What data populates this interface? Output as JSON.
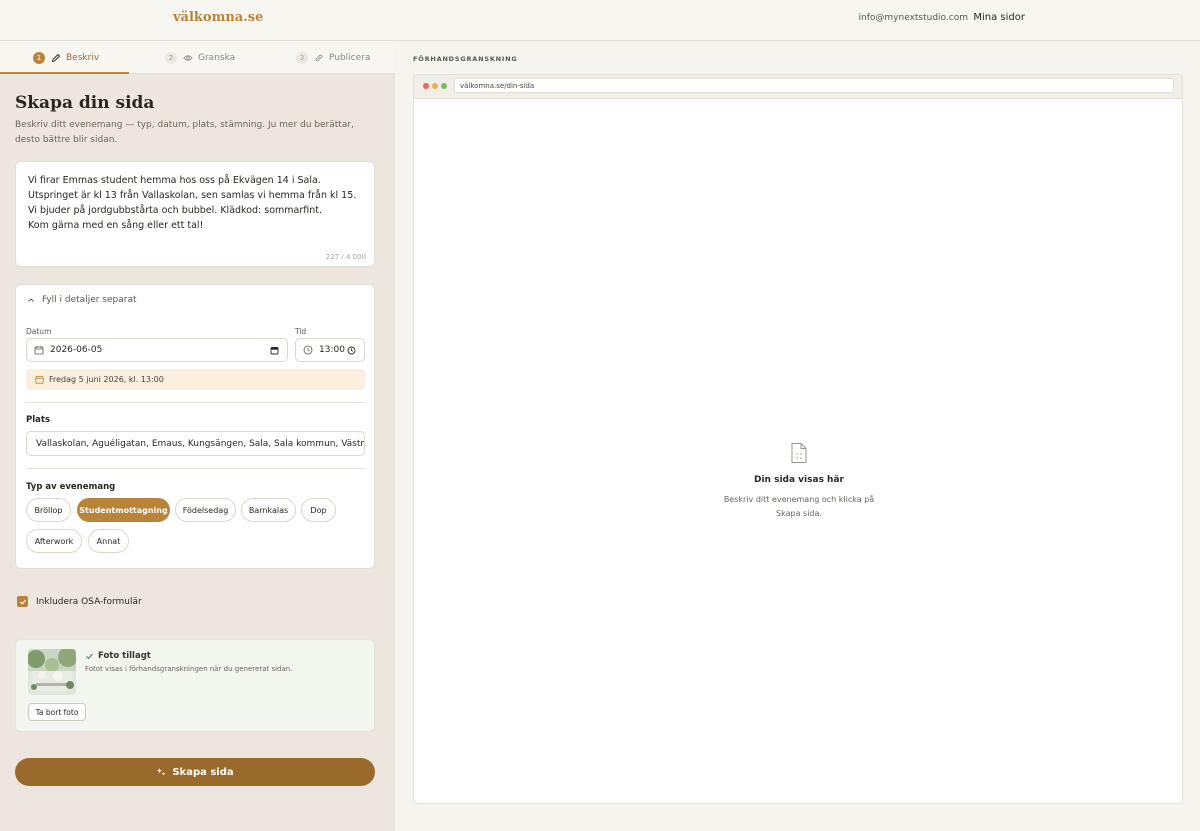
{
  "header": {
    "logo": "välkomna.se",
    "email": "info@mynextstudio.com",
    "my_pages": "Mina sidor"
  },
  "steps": [
    {
      "num": "1",
      "label": "Beskriv",
      "icon": "pencil-icon",
      "active": true
    },
    {
      "num": "2",
      "label": "Granska",
      "icon": "eye-icon",
      "active": false
    },
    {
      "num": "3",
      "label": "Publicera",
      "icon": "link-icon",
      "active": false
    }
  ],
  "form": {
    "title": "Skapa din sida",
    "subtitle": "Beskriv ditt evenemang — typ, datum, plats, stämning. Ju mer du berättar, desto bättre blir sidan.",
    "description": "Vi firar Emmas student hemma hos oss på Ekvägen 14 i Sala. Utspringet är kl 13 från Vallaskolan, sen samlas vi hemma från kl 15. Vi bjuder på jordgubbstårta och bubbel. Klädkod: sommarfint.\nKom gärna med en sång eller ett tal!",
    "char_count": "227 / 4 000",
    "details_toggle": "Fyll i detaljer separat",
    "date_label": "Datum",
    "date_value": "2026-06-05",
    "time_label": "Tid",
    "time_value": "13:00",
    "date_summary": "Fredag 5 juni 2026, kl. 13:00",
    "place_label": "Plats",
    "place_value": "Vallaskolan, Aguéligatan, Emaus, Kungsängen, Sala, Sala kommun, Västmanlands",
    "type_label": "Typ av evenemang",
    "event_types": [
      {
        "label": "Bröllop",
        "active": false
      },
      {
        "label": "Studentmottagning",
        "active": true
      },
      {
        "label": "Födelsedag",
        "active": false
      },
      {
        "label": "Barnkalas",
        "active": false
      },
      {
        "label": "Dop",
        "active": false
      },
      {
        "label": "Afterwork",
        "active": false
      },
      {
        "label": "Annat",
        "active": false
      }
    ],
    "osa_label": "Inkludera OSA-formulär",
    "osa_checked": true,
    "photo_title": "Foto tillagt",
    "photo_desc": "Fotot visas i förhandsgranskningen när du genererat sidan.",
    "remove_photo": "Ta bort foto",
    "submit": "Skapa sida"
  },
  "preview": {
    "label": "FÖRHANDSGRANSKNING",
    "url": "välkomna.se/din-sida",
    "empty_title": "Din sida visas här",
    "empty_desc": "Beskriv ditt evenemang och klicka på Skapa sida."
  },
  "colors": {
    "accent": "#b9833a",
    "button": "#9a6a2c",
    "panel_bg": "#ece6df"
  }
}
